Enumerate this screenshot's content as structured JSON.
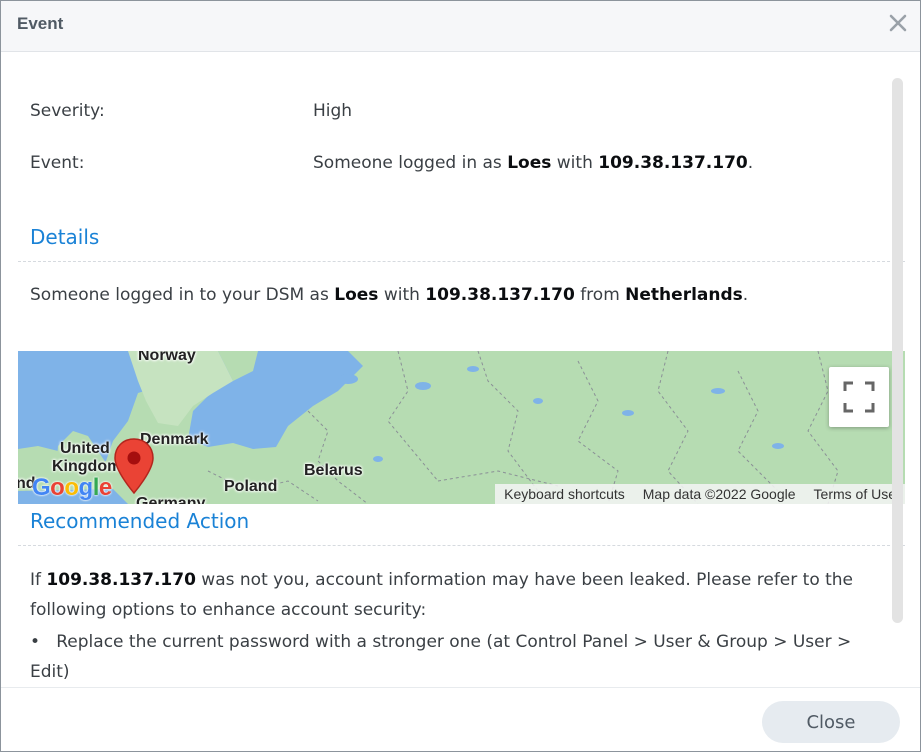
{
  "dialog": {
    "title": "Event"
  },
  "info": {
    "severity_label": "Severity:",
    "severity_value": "High",
    "event_label": "Event:",
    "event_pre": "Someone logged in as ",
    "event_user": "Loes",
    "event_mid": " with ",
    "event_ip": "109.38.137.170",
    "event_end": "."
  },
  "details": {
    "title": "Details",
    "pre": "Someone logged in to your DSM as ",
    "user": "Loes",
    "mid": " with ",
    "ip": "109.38.137.170",
    "mid2": " from ",
    "country": "Netherlands",
    "end": "."
  },
  "map": {
    "labels": {
      "norway": "Norway",
      "denmark": "Denmark",
      "united": "United",
      "kingdom": "Kingdom",
      "belarus": "Belarus",
      "poland": "Poland",
      "ireland_fragment": "nd",
      "germany_fragment": "Germany"
    },
    "logo": "Google",
    "attribution": {
      "keyboard": "Keyboard shortcuts",
      "map_data": "Map data ©2022 Google",
      "terms": "Terms of Use"
    },
    "icons": {
      "pin": "map-pin-icon",
      "fullscreen": "fullscreen-icon"
    },
    "colors": {
      "land": "#b6dcb2",
      "water": "#7fb3e8",
      "pin": "#ea4335"
    }
  },
  "recommended": {
    "title": "Recommended Action",
    "pre": "If ",
    "ip": "109.38.137.170",
    "rest": " was not you, account information may have been leaked. Please refer to the following options to enhance account security:",
    "bullet": "•",
    "bullet_text": "Replace the current password with a stronger one (at Control Panel > User & Group > User > Edit)"
  },
  "footer": {
    "close_label": "Close"
  },
  "icons": {
    "close": "close-icon"
  },
  "colors": {
    "accent": "#1a82d6",
    "button_bg": "#e6ebf0"
  }
}
